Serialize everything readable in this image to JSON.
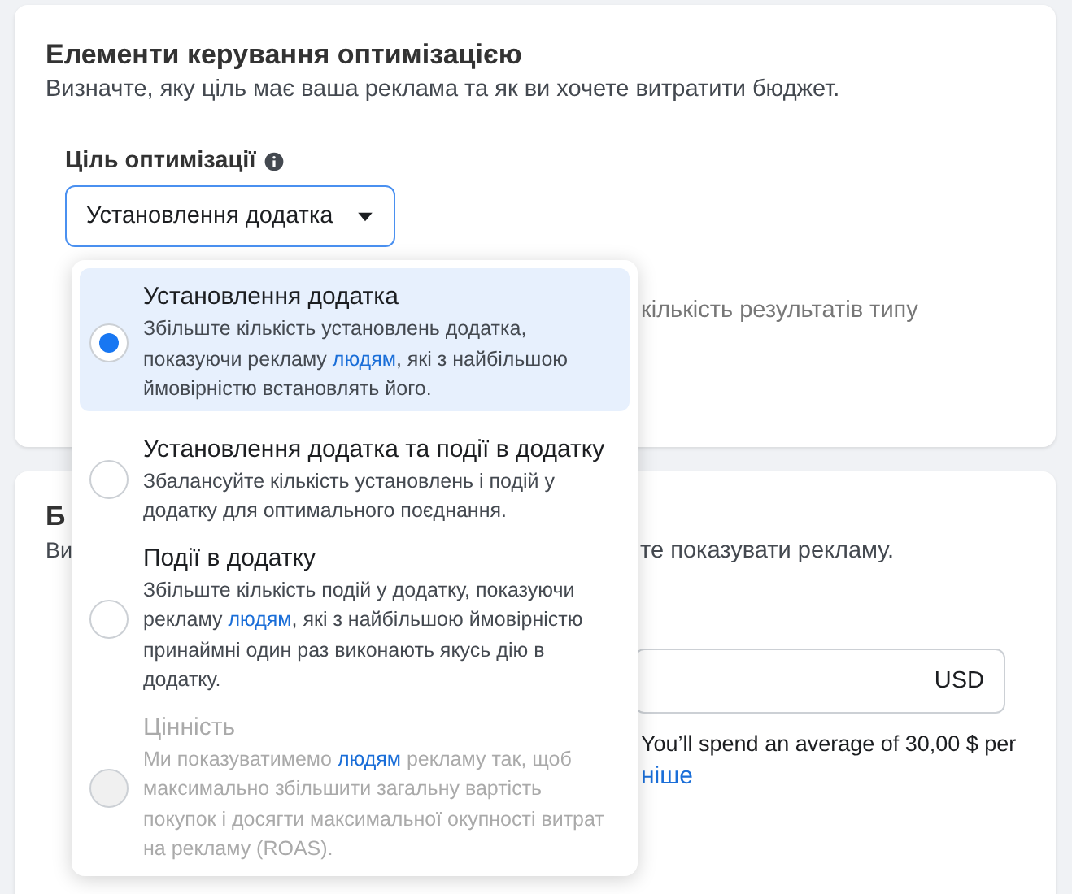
{
  "optimization": {
    "title": "Елементи керування оптимізацією",
    "description": "Визначте, яку ціль має ваша реклама та як ви хочете витратити бюджет.",
    "field_label": "Ціль оптимізації",
    "dropdown": {
      "value": "Установлення додатка"
    },
    "partial_text": "кількість результатів типу"
  },
  "budget": {
    "title_fragment": "Б",
    "description_start": "Ви",
    "description_end": "те показувати рекламу.",
    "currency": "USD",
    "spend_note": "You’ll spend an average of 30,00 $ per",
    "link_fragment": "ніше"
  },
  "menu": {
    "options": [
      {
        "title": "Установлення додатка",
        "before": "Збільште кількість установлень додатка, показуючи рекламу ",
        "link": "людям",
        "after": ", які з найбільшою ймовірністю встановлять його.",
        "selected": true,
        "disabled": false
      },
      {
        "title": "Установлення додатка та події в додатку",
        "before": "Збалансуйте кількість установлень і подій у додатку для оптимального поєднання.",
        "selected": false,
        "disabled": false
      },
      {
        "title": "Події в додатку",
        "before": "Збільште кількість подій у додатку, показуючи рекламу ",
        "link": "людям",
        "after": ", які з найбільшою ймовірністю принаймні один раз виконають якусь дію в додатку.",
        "selected": false,
        "disabled": false
      },
      {
        "title": "Цінність",
        "before": "Ми показуватимемо ",
        "link": "людям",
        "after": " рекламу так, щоб максимально збільшити загальну вартість покупок і досягти максимальної окупності витрат на рекламу (ROAS).",
        "selected": false,
        "disabled": true
      }
    ]
  }
}
